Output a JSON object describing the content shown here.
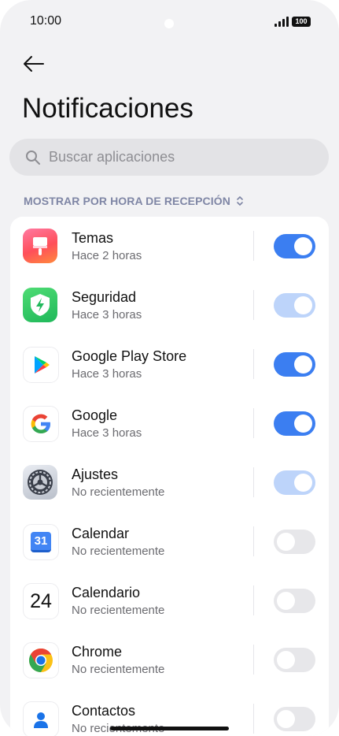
{
  "status_bar": {
    "time": "10:00",
    "battery": "100"
  },
  "header": {
    "title": "Notificaciones"
  },
  "search": {
    "placeholder": "Buscar aplicaciones"
  },
  "sort": {
    "label": "MOSTRAR POR HORA DE RECEPCIÓN"
  },
  "apps": [
    {
      "name": "Temas",
      "time": "Hace 2 horas",
      "toggle": "on",
      "icon": "theme-brush-icon"
    },
    {
      "name": "Seguridad",
      "time": "Hace 3 horas",
      "toggle": "on-disabled",
      "icon": "security-shield-icon"
    },
    {
      "name": "Google Play Store",
      "time": "Hace 3 horas",
      "toggle": "on",
      "icon": "play-store-icon"
    },
    {
      "name": "Google",
      "time": "Hace 3 horas",
      "toggle": "on",
      "icon": "google-g-icon"
    },
    {
      "name": "Ajustes",
      "time": "No recientemente",
      "toggle": "on-disabled",
      "icon": "settings-gear-icon"
    },
    {
      "name": "Calendar",
      "time": "No recientemente",
      "toggle": "off",
      "icon": "google-calendar-icon",
      "icon_text": "31"
    },
    {
      "name": "Calendario",
      "time": "No recientemente",
      "toggle": "off",
      "icon": "calendario-icon",
      "icon_text": "24"
    },
    {
      "name": "Chrome",
      "time": "No recientemente",
      "toggle": "off",
      "icon": "chrome-icon"
    },
    {
      "name": "Contactos",
      "time": "No recientemente",
      "toggle": "off",
      "icon": "contacts-icon"
    }
  ],
  "colors": {
    "accent": "#3b7ef1",
    "accent_disabled": "#bdd4fa",
    "toggle_off": "#e7e7ea",
    "background": "#f2f2f4"
  }
}
